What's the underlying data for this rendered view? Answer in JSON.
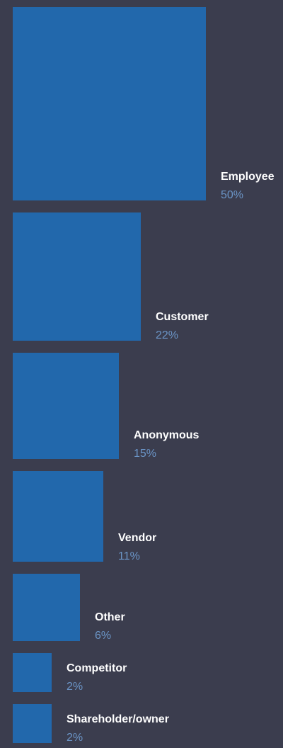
{
  "chart_data": {
    "type": "bar",
    "categories": [
      "Employee",
      "Customer",
      "Anonymous",
      "Vendor",
      "Other",
      "Competitor",
      "Shareholder/owner"
    ],
    "values": [
      50,
      22,
      15,
      11,
      6,
      2,
      2
    ],
    "value_labels": [
      "50%",
      "22%",
      "15%",
      "11%",
      "6%",
      "2%",
      "2%"
    ],
    "title": "",
    "xlabel": "",
    "ylabel": "",
    "encoding": "square area proportional to percentage",
    "colors": {
      "background": "#3b3d4e",
      "square": "#2268ac",
      "category_text": "#ffffff",
      "value_text": "#6b95c7"
    }
  }
}
